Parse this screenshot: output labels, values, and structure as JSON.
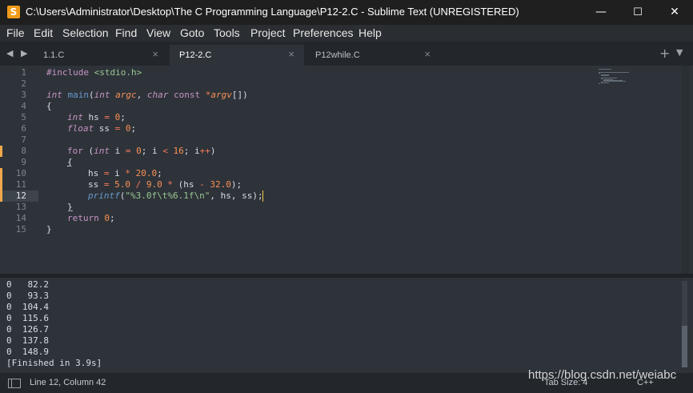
{
  "window": {
    "title": "C:\\Users\\Administrator\\Desktop\\The C Programming Language\\P12-2.C - Sublime Text (UNREGISTERED)",
    "app_icon": "S",
    "minimize_icon": "—",
    "maximize_icon": "☐",
    "close_icon": "✕"
  },
  "menu": [
    "File",
    "Edit",
    "Selection",
    "Find",
    "View",
    "Goto",
    "Tools",
    "Project",
    "Preferences",
    "Help"
  ],
  "tabs": [
    {
      "label": "1.1.C",
      "close": "×",
      "active": false
    },
    {
      "label": "P12-2.C",
      "close": "×",
      "active": true
    },
    {
      "label": "P12while.C",
      "close": "×",
      "active": false
    }
  ],
  "tab_nav": "◀ ▶",
  "tab_plus": "+",
  "tab_dropdown": "▼",
  "editor": {
    "line_numbers": [
      "1",
      "2",
      "3",
      "4",
      "5",
      "6",
      "7",
      "8",
      "9",
      "10",
      "11",
      "12",
      "13",
      "14",
      "15"
    ],
    "current_line": 12,
    "modified_lines": [
      8,
      10,
      11,
      12
    ],
    "tokens": {
      "l1_directive": "#include",
      "l1_header": "<stdio.h>",
      "l3_type_int": "int",
      "l3_main": "main",
      "l3_open": "(",
      "l3_int": "int",
      "l3_argc": "argc",
      "l3_comma": ", ",
      "l3_char": "char",
      "l3_const": "const",
      "l3_star": "*",
      "l3_argv": "argv",
      "l3_close": "[])",
      "l4": "{",
      "l5_int": "int",
      "l5_a": " hs ",
      "l5_eq": "=",
      "l5_zero": "0",
      "l5_semi": ";",
      "l6_float": "float",
      "l6_a": " ss ",
      "l6_eq": "=",
      "l6_zero": "0",
      "l6_semi": ";",
      "l8_for": "for",
      "l8_open": " (",
      "l8_int": "int",
      "l8_i": " i ",
      "l8_eq": "=",
      "l8_zero": "0",
      "l8_b": "; i ",
      "l8_lt": "<",
      "l8_sixteen": "16",
      "l8_c": "; i",
      "l8_inc": "++",
      "l8_close": ")",
      "l9": "{",
      "l10_a": "hs ",
      "l10_eq": "=",
      "l10_b": " i ",
      "l10_mul": "*",
      "l10_num": "20.0",
      "l10_semi": ";",
      "l11_a": "ss ",
      "l11_eq": "=",
      "l11_n1": "5.0",
      "l11_div": "/",
      "l11_n2": "9.0",
      "l11_mul": "*",
      "l11_b": " (hs ",
      "l11_minus": "-",
      "l11_n3": "32.0",
      "l11_c": ");",
      "l12_printf": "printf",
      "l12_open": "(",
      "l12_str": "\"%3.0f\\t%6.1f\\n\"",
      "l12_rest": ", hs, ss);",
      "l13": "}",
      "l14_return": "return",
      "l14_zero": "0",
      "l14_semi": ";",
      "l15": "}"
    }
  },
  "output_lines": [
    "0   82.2",
    "0   93.3",
    "0  104.4",
    "0  115.6",
    "0  126.7",
    "0  137.8",
    "0  148.9",
    "[Finished in 3.9s]"
  ],
  "status": {
    "position": "Line 12, Column 42",
    "tab_size": "Tab Size: 4",
    "syntax": "C++"
  },
  "watermark": "https://blog.csdn.net/weiabc"
}
